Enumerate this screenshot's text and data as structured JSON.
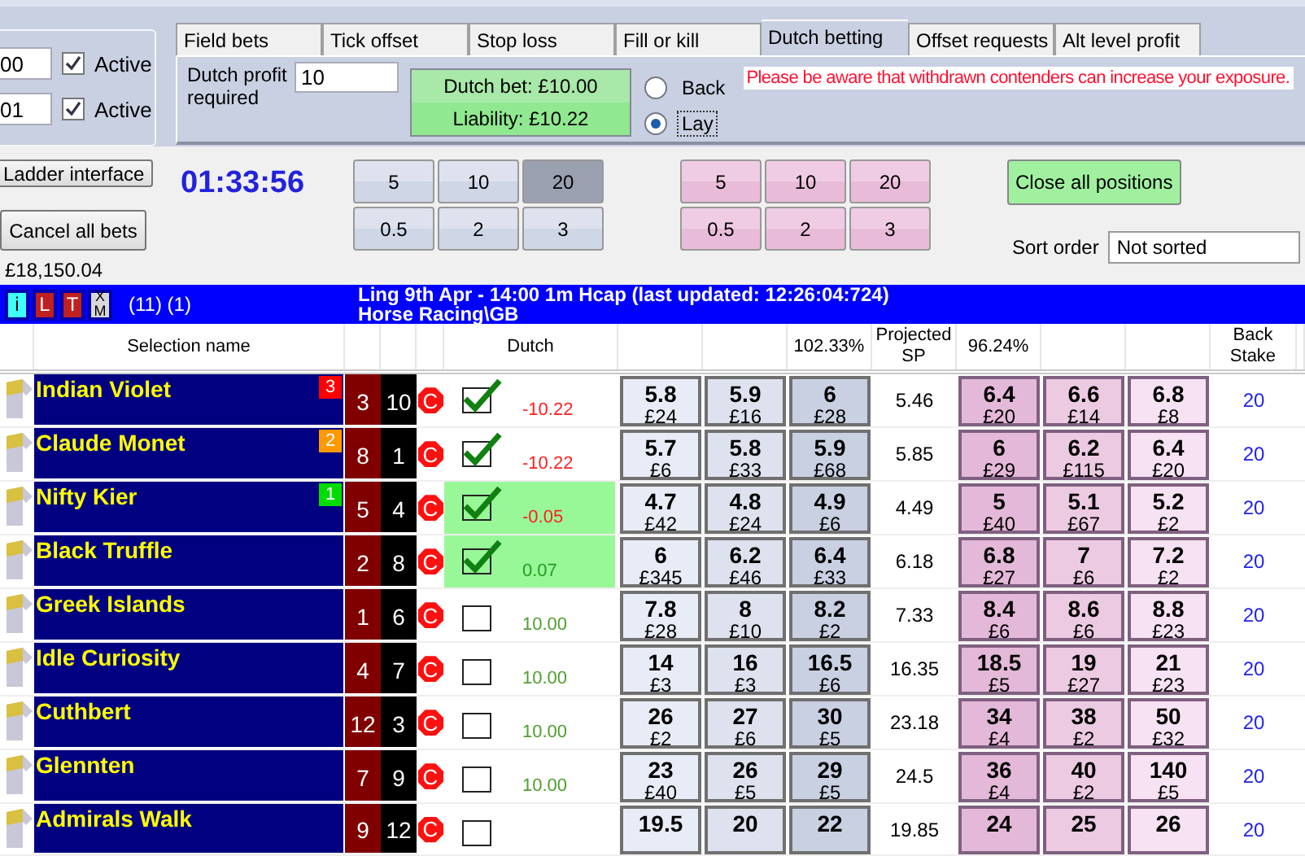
{
  "settings": {
    "rows": [
      {
        "value": "00",
        "active_label": "Active",
        "checked": true
      },
      {
        "value": "01",
        "active_label": "Active",
        "checked": true
      }
    ]
  },
  "tabs": [
    {
      "label": "Field bets",
      "selected": false
    },
    {
      "label": "Tick offset",
      "selected": false
    },
    {
      "label": "Stop loss",
      "selected": false
    },
    {
      "label": "Fill or kill",
      "selected": false
    },
    {
      "label": "Dutch betting",
      "selected": true
    },
    {
      "label": "Offset requests",
      "selected": false
    },
    {
      "label": "Alt level profit",
      "selected": false
    }
  ],
  "dutch_panel": {
    "profit_label": "Dutch profit required",
    "profit_value": "10",
    "dutch_bet": "Dutch bet: £10.00",
    "liability": "Liability: £10.22",
    "options": [
      {
        "label": "Back",
        "selected": false
      },
      {
        "label": "Lay",
        "selected": true
      }
    ],
    "warning": "Please be aware that withdrawn contenders can increase your exposure."
  },
  "controls": {
    "ladder_button": "Ladder interface",
    "cancel_button": "Cancel all bets",
    "balance": "£18,150.04",
    "timer": "01:33:56",
    "back_stakes": [
      {
        "label": "5",
        "selected": false
      },
      {
        "label": "10",
        "selected": false
      },
      {
        "label": "20",
        "selected": true
      },
      {
        "label": "0.5",
        "selected": false
      },
      {
        "label": "2",
        "selected": false
      },
      {
        "label": "3",
        "selected": false
      }
    ],
    "lay_stakes": [
      {
        "label": "5",
        "selected": false
      },
      {
        "label": "10",
        "selected": false
      },
      {
        "label": "20",
        "selected": false
      },
      {
        "label": "0.5",
        "selected": false
      },
      {
        "label": "2",
        "selected": false
      },
      {
        "label": "3",
        "selected": false
      }
    ],
    "close_button": "Close all positions",
    "sort_label": "Sort order",
    "sort_value": "Not sorted"
  },
  "market_bar": {
    "buttons": [
      {
        "label": "i",
        "kind": "info"
      },
      {
        "label": "L",
        "kind": "alert"
      },
      {
        "label": "T",
        "kind": "alert"
      },
      {
        "label": "XM",
        "kind": "plain"
      }
    ],
    "counts": "(11) (1)",
    "title": "Ling 9th Apr - 14:00 1m Hcap (last updated: 12:26:04:724)",
    "subtitle": "Horse Racing\\GB"
  },
  "table": {
    "columns": {
      "selection": "Selection name",
      "dutch": "Dutch",
      "back_book": "102.33%",
      "projected_sp": "Projected SP",
      "lay_book": "96.24%",
      "back_stake": "Back Stake"
    },
    "rows": [
      {
        "name": "Indian Violet",
        "rank": {
          "label": "3",
          "color": "#ff0000"
        },
        "stall": "3",
        "cloth": "10",
        "status": "C",
        "dutch": {
          "checked": true,
          "highlighted": false,
          "value": "-10.22",
          "color": "#ff2020"
        },
        "back": [
          {
            "price": "5.8",
            "amount": "£24"
          },
          {
            "price": "5.9",
            "amount": "£16"
          },
          {
            "price": "6",
            "amount": "£28"
          }
        ],
        "projected_sp": "5.46",
        "lay": [
          {
            "price": "6.4",
            "amount": "£20"
          },
          {
            "price": "6.6",
            "amount": "£14"
          },
          {
            "price": "6.8",
            "amount": "£8"
          }
        ],
        "back_stake": "20"
      },
      {
        "name": "Claude Monet",
        "rank": {
          "label": "2",
          "color": "#ff9900"
        },
        "stall": "8",
        "cloth": "1",
        "status": "C",
        "dutch": {
          "checked": true,
          "highlighted": false,
          "value": "-10.22",
          "color": "#ff2020"
        },
        "back": [
          {
            "price": "5.7",
            "amount": "£6"
          },
          {
            "price": "5.8",
            "amount": "£33"
          },
          {
            "price": "5.9",
            "amount": "£68"
          }
        ],
        "projected_sp": "5.85",
        "lay": [
          {
            "price": "6",
            "amount": "£29"
          },
          {
            "price": "6.2",
            "amount": "£115"
          },
          {
            "price": "6.4",
            "amount": "£20"
          }
        ],
        "back_stake": "20"
      },
      {
        "name": "Nifty Kier",
        "rank": {
          "label": "1",
          "color": "#00dd00"
        },
        "stall": "5",
        "cloth": "4",
        "status": "C",
        "dutch": {
          "checked": true,
          "highlighted": true,
          "value": "-0.05",
          "color": "#ff2020"
        },
        "back": [
          {
            "price": "4.7",
            "amount": "£42"
          },
          {
            "price": "4.8",
            "amount": "£24"
          },
          {
            "price": "4.9",
            "amount": "£6"
          }
        ],
        "projected_sp": "4.49",
        "lay": [
          {
            "price": "5",
            "amount": "£40"
          },
          {
            "price": "5.1",
            "amount": "£67"
          },
          {
            "price": "5.2",
            "amount": "£2"
          }
        ],
        "back_stake": "20"
      },
      {
        "name": "Black Truffle",
        "stall": "2",
        "cloth": "8",
        "status": "C",
        "dutch": {
          "checked": true,
          "highlighted": true,
          "value": "0.07",
          "color": "#20a020"
        },
        "back": [
          {
            "price": "6",
            "amount": "£345"
          },
          {
            "price": "6.2",
            "amount": "£46"
          },
          {
            "price": "6.4",
            "amount": "£33"
          }
        ],
        "projected_sp": "6.18",
        "lay": [
          {
            "price": "6.8",
            "amount": "£27"
          },
          {
            "price": "7",
            "amount": "£6"
          },
          {
            "price": "7.2",
            "amount": "£2"
          }
        ],
        "back_stake": "20"
      },
      {
        "name": "Greek Islands",
        "stall": "1",
        "cloth": "6",
        "status": "C",
        "dutch": {
          "checked": false,
          "highlighted": false,
          "value": "10.00",
          "color": "#50a030"
        },
        "back": [
          {
            "price": "7.8",
            "amount": "£28"
          },
          {
            "price": "8",
            "amount": "£10"
          },
          {
            "price": "8.2",
            "amount": "£2"
          }
        ],
        "projected_sp": "7.33",
        "lay": [
          {
            "price": "8.4",
            "amount": "£6"
          },
          {
            "price": "8.6",
            "amount": "£6"
          },
          {
            "price": "8.8",
            "amount": "£23"
          }
        ],
        "back_stake": "20"
      },
      {
        "name": "Idle Curiosity",
        "stall": "4",
        "cloth": "7",
        "status": "C",
        "dutch": {
          "checked": false,
          "highlighted": false,
          "value": "10.00",
          "color": "#50a030"
        },
        "back": [
          {
            "price": "14",
            "amount": "£3"
          },
          {
            "price": "16",
            "amount": "£3"
          },
          {
            "price": "16.5",
            "amount": "£6"
          }
        ],
        "projected_sp": "16.35",
        "lay": [
          {
            "price": "18.5",
            "amount": "£5"
          },
          {
            "price": "19",
            "amount": "£27"
          },
          {
            "price": "21",
            "amount": "£23"
          }
        ],
        "back_stake": "20"
      },
      {
        "name": "Cuthbert",
        "stall": "12",
        "cloth": "3",
        "status": "C",
        "dutch": {
          "checked": false,
          "highlighted": false,
          "value": "10.00",
          "color": "#50a030"
        },
        "back": [
          {
            "price": "26",
            "amount": "£2"
          },
          {
            "price": "27",
            "amount": "£6"
          },
          {
            "price": "30",
            "amount": "£5"
          }
        ],
        "projected_sp": "23.18",
        "lay": [
          {
            "price": "34",
            "amount": "£4"
          },
          {
            "price": "38",
            "amount": "£2"
          },
          {
            "price": "50",
            "amount": "£32"
          }
        ],
        "back_stake": "20"
      },
      {
        "name": "Glennten",
        "stall": "7",
        "cloth": "9",
        "status": "C",
        "dutch": {
          "checked": false,
          "highlighted": false,
          "value": "10.00",
          "color": "#50a030"
        },
        "back": [
          {
            "price": "23",
            "amount": "£40"
          },
          {
            "price": "26",
            "amount": "£5"
          },
          {
            "price": "29",
            "amount": "£5"
          }
        ],
        "projected_sp": "24.5",
        "lay": [
          {
            "price": "36",
            "amount": "£4"
          },
          {
            "price": "40",
            "amount": "£2"
          },
          {
            "price": "140",
            "amount": "£5"
          }
        ],
        "back_stake": "20"
      },
      {
        "name": "Admirals Walk",
        "stall": "9",
        "cloth": "12",
        "status": "C",
        "dutch": {
          "checked": false,
          "highlighted": false
        },
        "back": [
          {
            "price": "19.5"
          },
          {
            "price": "20"
          },
          {
            "price": "22"
          }
        ],
        "projected_sp": "19.85",
        "lay": [
          {
            "price": "24"
          },
          {
            "price": "25"
          },
          {
            "price": "26"
          }
        ],
        "back_stake": "20"
      }
    ]
  }
}
